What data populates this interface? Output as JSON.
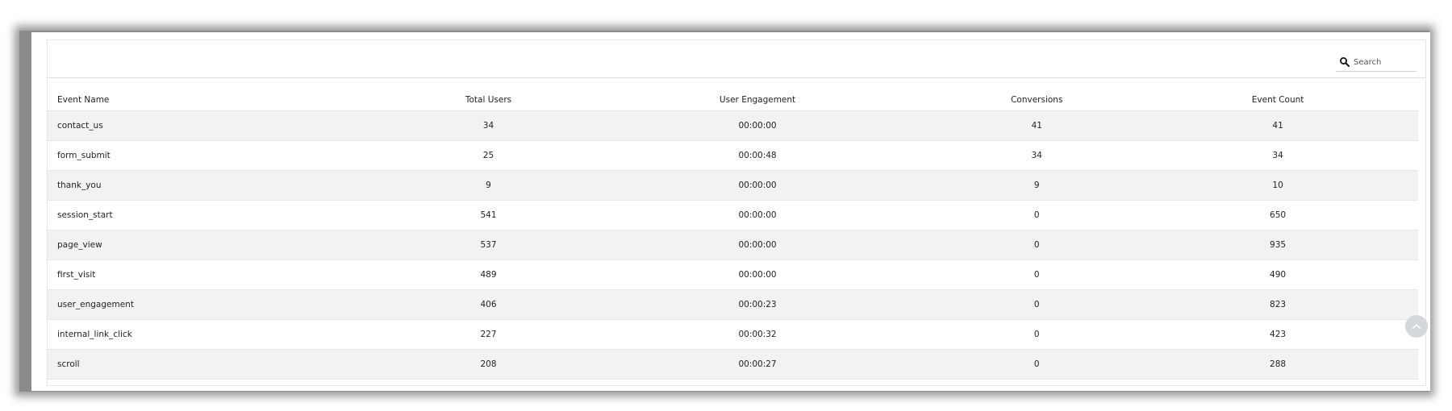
{
  "search": {
    "placeholder": "Search",
    "icon": "search-icon"
  },
  "table": {
    "columns": [
      "Event Name",
      "Total Users",
      "User Engagement",
      "Conversions",
      "Event Count"
    ],
    "rows": [
      {
        "event_name": "contact_us",
        "total_users": "34",
        "user_engagement": "00:00:00",
        "conversions": "41",
        "event_count": "41"
      },
      {
        "event_name": "form_submit",
        "total_users": "25",
        "user_engagement": "00:00:48",
        "conversions": "34",
        "event_count": "34"
      },
      {
        "event_name": "thank_you",
        "total_users": "9",
        "user_engagement": "00:00:00",
        "conversions": "9",
        "event_count": "10"
      },
      {
        "event_name": "session_start",
        "total_users": "541",
        "user_engagement": "00:00:00",
        "conversions": "0",
        "event_count": "650"
      },
      {
        "event_name": "page_view",
        "total_users": "537",
        "user_engagement": "00:00:00",
        "conversions": "0",
        "event_count": "935"
      },
      {
        "event_name": "first_visit",
        "total_users": "489",
        "user_engagement": "00:00:00",
        "conversions": "0",
        "event_count": "490"
      },
      {
        "event_name": "user_engagement",
        "total_users": "406",
        "user_engagement": "00:00:23",
        "conversions": "0",
        "event_count": "823"
      },
      {
        "event_name": "internal_link_click",
        "total_users": "227",
        "user_engagement": "00:00:32",
        "conversions": "0",
        "event_count": "423"
      },
      {
        "event_name": "scroll",
        "total_users": "208",
        "user_engagement": "00:00:27",
        "conversions": "0",
        "event_count": "288"
      }
    ]
  },
  "scroll_top": {
    "icon": "chevron-up-icon"
  }
}
